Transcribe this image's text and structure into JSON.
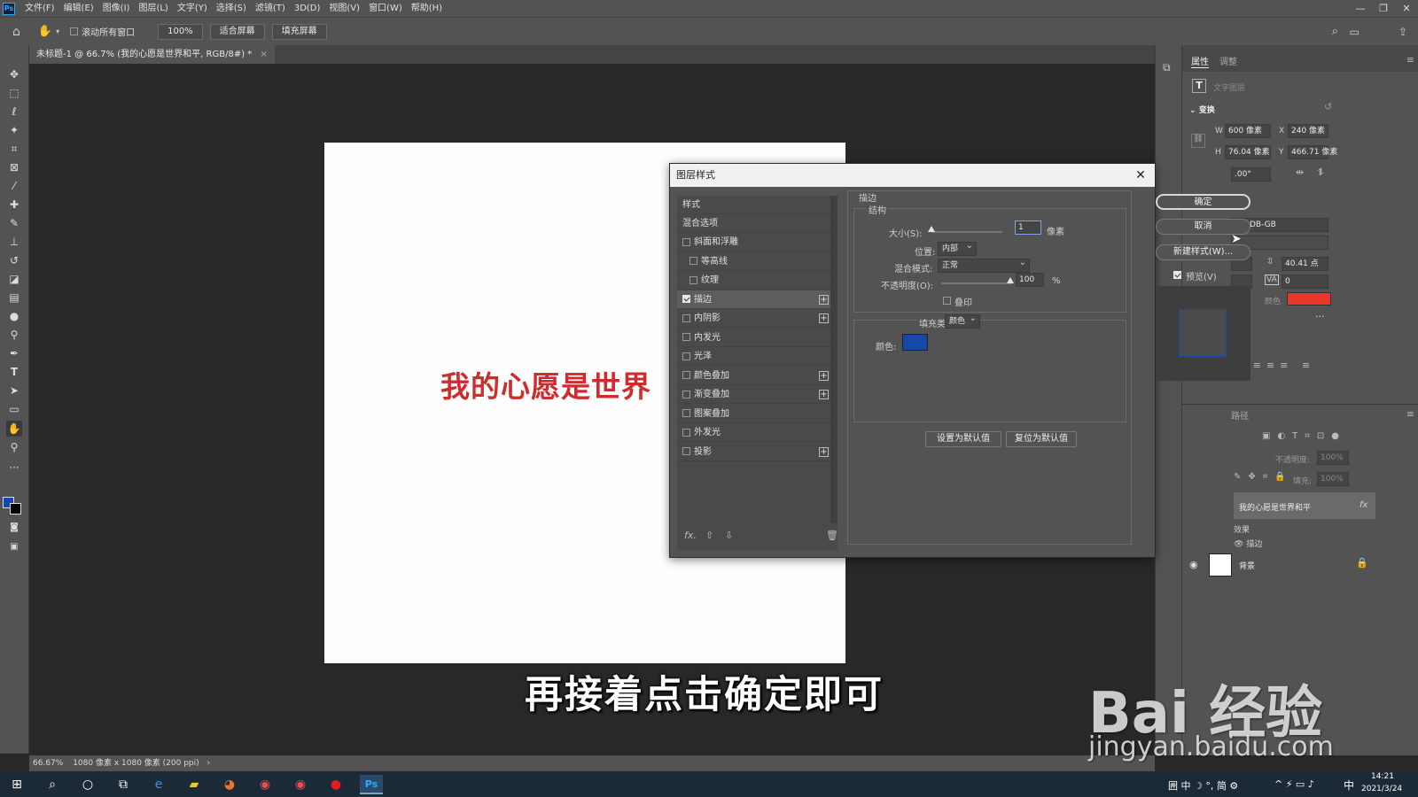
{
  "menubar": {
    "app_icon": "Ps",
    "items": [
      "文件(F)",
      "编辑(E)",
      "图像(I)",
      "图层(L)",
      "文字(Y)",
      "选择(S)",
      "滤镜(T)",
      "3D(D)",
      "视图(V)",
      "窗口(W)",
      "帮助(H)"
    ],
    "window_controls": [
      "—",
      "❐",
      "✕"
    ]
  },
  "optionsbar": {
    "scroll_all_label": "滚动所有窗口",
    "zoom": "100%",
    "fit_screen": "适合屏幕",
    "fill_screen": "填充屏幕"
  },
  "document": {
    "tab_title": "未标题-1 @ 66.7% (我的心愿是世界和平, RGB/8#) *",
    "canvas_text": "我的心愿是世界",
    "canvas_bg": "#fefefe",
    "text_color": "#cf2d2d"
  },
  "statusbar": {
    "zoom": "66.67%",
    "info": "1080 像素 x 1080 像素 (200 ppi)"
  },
  "properties": {
    "tab_properties": "属性",
    "tab_adjust": "调整",
    "layer_type": "文字图层",
    "transform_title": "变换",
    "w_label": "W",
    "w_value": "600 像素",
    "x_label": "X",
    "x_value": "240 像素",
    "h_label": "H",
    "h_value": "76.04 像素",
    "y_label": "Y",
    "y_value": "466.71 像素",
    "angle_value": ".00°",
    "font_name": "eiS-DB-GB",
    "leading_value": "40.41 点",
    "tracking_value": "0",
    "color_label": "颜色",
    "text_swatch": "#e8362a",
    "more": "···"
  },
  "layers": {
    "tab_paths": "路径",
    "opacity_label": "不透明度:",
    "opacity_value": "100%",
    "fill_label": "填充:",
    "fill_value": "100%",
    "text_layer_name": "我的心愿是世界和平",
    "fx_label": "fx",
    "effects_label": "效果",
    "stroke_effect": "描边",
    "bg_layer_name": "背景"
  },
  "dialog": {
    "title": "图层样式",
    "close": "✕",
    "styles_header": "样式",
    "blend_options": "混合选项",
    "items": [
      {
        "label": "斜面和浮雕",
        "checked": false,
        "plus": false,
        "indent": false
      },
      {
        "label": "等高线",
        "checked": false,
        "plus": false,
        "indent": true
      },
      {
        "label": "纹理",
        "checked": false,
        "plus": false,
        "indent": true
      },
      {
        "label": "描边",
        "checked": true,
        "plus": true,
        "indent": false
      },
      {
        "label": "内阴影",
        "checked": false,
        "plus": true,
        "indent": false
      },
      {
        "label": "内发光",
        "checked": false,
        "plus": false,
        "indent": false
      },
      {
        "label": "光泽",
        "checked": false,
        "plus": false,
        "indent": false
      },
      {
        "label": "颜色叠加",
        "checked": false,
        "plus": true,
        "indent": false
      },
      {
        "label": "渐变叠加",
        "checked": false,
        "plus": true,
        "indent": false
      },
      {
        "label": "图案叠加",
        "checked": false,
        "plus": false,
        "indent": false
      },
      {
        "label": "外发光",
        "checked": false,
        "plus": false,
        "indent": false
      },
      {
        "label": "投影",
        "checked": false,
        "plus": true,
        "indent": false
      }
    ],
    "bottom_fx": "fx.",
    "section_title": "描边",
    "structure_title": "结构",
    "size_label": "大小(S):",
    "size_value": "1",
    "size_unit": "像素",
    "position_label": "位置:",
    "position_value": "内部",
    "blend_mode_label": "混合模式:",
    "blend_mode_value": "正常",
    "opacity_label": "不透明度(O):",
    "opacity_value": "100",
    "opacity_unit": "%",
    "overprint_label": "叠印",
    "fill_type_label": "填充类型:",
    "fill_type_value": "颜色",
    "color_label": "颜色:",
    "stroke_color": "#1548a8",
    "set_default": "设置为默认值",
    "reset_default": "复位为默认值",
    "ok": "确定",
    "cancel": "取消",
    "new_style": "新建样式(W)...",
    "preview_label": "预览(V)"
  },
  "caption": "再接着点击确定即可",
  "watermark": {
    "line1": "Bai 经验",
    "line2": "jingyan.baidu.com"
  },
  "taskbar": {
    "tray_text": "囲 中 ☽ °, 简 ⚙",
    "time": "14:21",
    "date": "2021/3/24",
    "ime": "中"
  }
}
